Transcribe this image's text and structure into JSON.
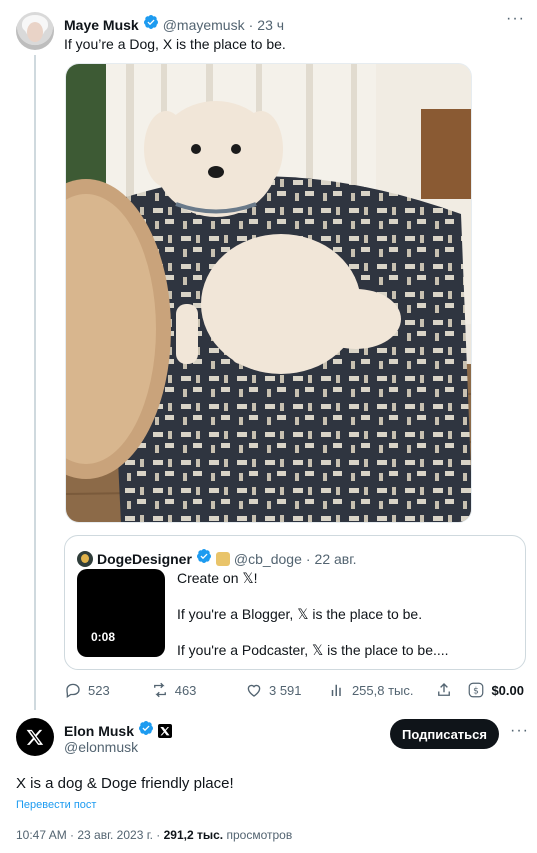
{
  "tweet1": {
    "name": "Maye Musk",
    "handle": "@mayemusk",
    "separator": "·",
    "time": "23 ч",
    "text": "If you’re a Dog, X is the place to be.",
    "photo_desc_icon": "dog-photo"
  },
  "quote": {
    "name": "DogeDesigner",
    "handle": "@cb_doge",
    "separator": "·",
    "time": "22 авг.",
    "video_duration": "0:08",
    "lines": [
      "Create on 𝕏!",
      "If you're a Blogger, 𝕏 is the place to be.",
      "If you're a Podcaster, 𝕏 is the place to be...."
    ]
  },
  "actions": {
    "replies": "523",
    "reposts": "463",
    "likes": "3 591",
    "views": "255,8 тыс.",
    "tips": "$0.00"
  },
  "tweet2": {
    "name": "Elon Musk",
    "handle": "@elonmusk",
    "subscribe_label": "Подписаться",
    "text": "X is a dog & Doge friendly place!",
    "translate_label": "Перевести пост",
    "time": "10:47 AM · 23 авг. 2023 г. ·",
    "views_count": "291,2 тыс.",
    "views_label": "просмотров"
  },
  "colors": {
    "verified": "#1d9bf0",
    "muted": "#536471",
    "link": "#1d9bf0"
  }
}
